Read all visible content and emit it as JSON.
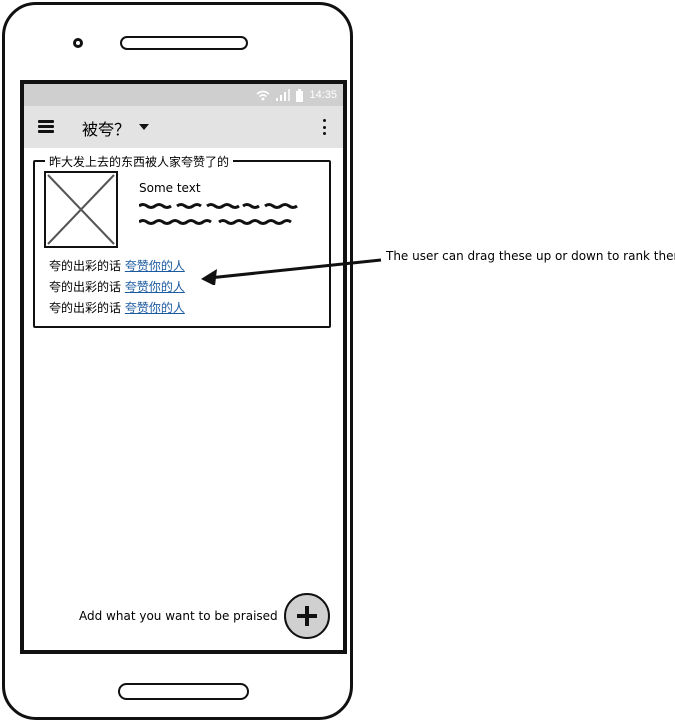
{
  "status_bar": {
    "time": "14:35"
  },
  "app_bar": {
    "title": "被夸？"
  },
  "card": {
    "legend": "昨大发上去的东西被人家夸赞了的",
    "heading": "Some text",
    "rows": [
      {
        "prefix": "夸的出彩的话",
        "link": "夸赞你的人"
      },
      {
        "prefix": "夸的出彩的话",
        "link": "夸赞你的人"
      },
      {
        "prefix": "夸的出彩的话",
        "link": "夸赞你的人"
      }
    ]
  },
  "add_prompt": "Add what you want to be praised",
  "annotation": "The user can drag these up or down to rank them",
  "icons": {
    "menu": "hamburger-icon",
    "dropdown": "chevron-down-icon",
    "overflow": "more-vert-icon",
    "image": "image-placeholder-icon",
    "add": "plus-icon",
    "wifi": "wifi-icon",
    "signal": "signal-icon",
    "battery": "battery-icon"
  }
}
